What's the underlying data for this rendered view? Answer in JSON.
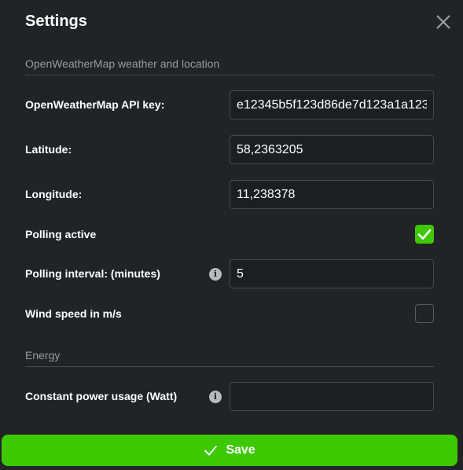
{
  "dialog": {
    "title": "Settings",
    "close_icon": "close-icon"
  },
  "sections": {
    "weather": "OpenWeatherMap weather and location",
    "energy": "Energy"
  },
  "fields": {
    "api_key": {
      "label": "OpenWeatherMap API key:",
      "value": "e12345b5f123d86de7d123a1a123"
    },
    "latitude": {
      "label": "Latitude:",
      "value": "58,2363205"
    },
    "longitude": {
      "label": "Longitude:",
      "value": "11,238378"
    },
    "polling_active": {
      "label": "Polling active",
      "checked": true
    },
    "polling_interval": {
      "label": "Polling interval: (minutes)",
      "value": "5",
      "icon": "info-icon"
    },
    "wind_speed": {
      "label": "Wind speed in m/s",
      "checked": false
    },
    "constant_power": {
      "label": "Constant power usage (Watt)",
      "value": "",
      "icon": "info-icon"
    }
  },
  "footer": {
    "save_label": "Save",
    "save_icon": "checkmark-icon"
  },
  "colors": {
    "background": "#222327",
    "accent": "#3dc800"
  }
}
